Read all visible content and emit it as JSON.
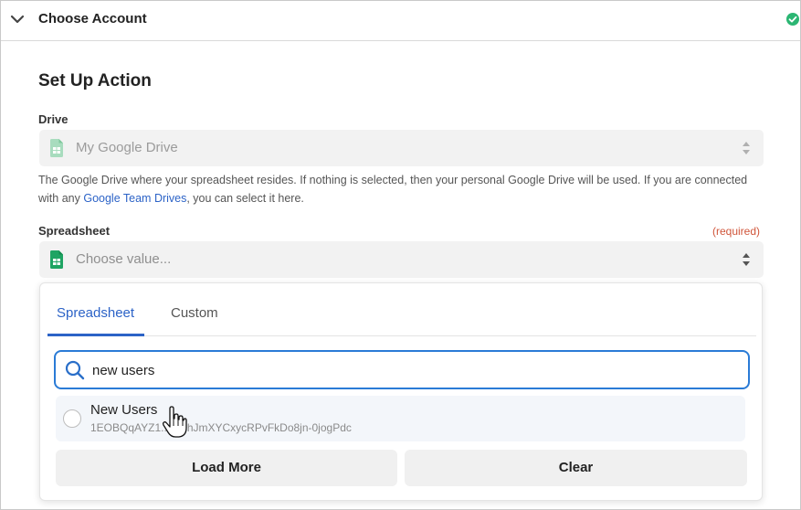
{
  "header": {
    "title": "Choose Account",
    "status_icon": "check-circle-icon",
    "collapse_icon": "chevron-down-icon",
    "accent_color": "#2bb673"
  },
  "section": {
    "title": "Set Up Action"
  },
  "drive": {
    "label": "Drive",
    "value": "My Google Drive",
    "help_before": "The Google Drive where your spreadsheet resides. If nothing is selected, then your personal Google Drive will be used. If you are connected with any ",
    "help_link": "Google Team Drives",
    "help_after": ", you can select it here."
  },
  "spreadsheet": {
    "label": "Spreadsheet",
    "required": "(required)",
    "placeholder": "Choose value..."
  },
  "dropdown": {
    "tabs": [
      {
        "label": "Spreadsheet",
        "active": true
      },
      {
        "label": "Custom",
        "active": false
      }
    ],
    "search_value": "new users",
    "results": [
      {
        "name": "New Users",
        "id": "1EOBQqAYZ1...QQhJmXYCxycRPvFkDo8jn-0jogPdc"
      }
    ],
    "load_more": "Load More",
    "clear": "Clear"
  },
  "colors": {
    "link": "#2c63c7",
    "required": "#d0553a",
    "focus_border": "#2a7bd6",
    "sheets_green": "#1fa463"
  }
}
